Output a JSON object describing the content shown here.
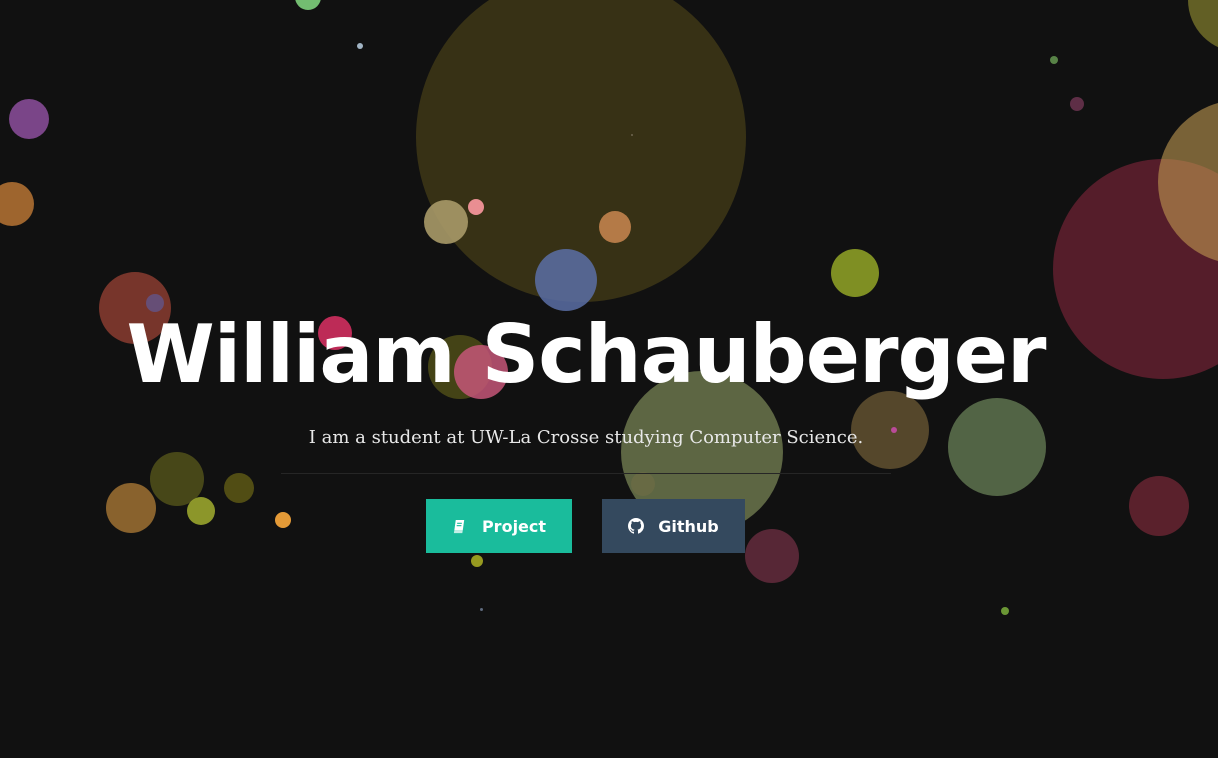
{
  "hero": {
    "name": "William Schauberger",
    "tagline": "I am a student at UW-La Crosse studying Computer Science."
  },
  "buttons": [
    {
      "label": "Project",
      "icon": "book-icon",
      "color": "#1abc9c"
    },
    {
      "label": "Github",
      "icon": "github-icon",
      "color": "#34495e"
    }
  ],
  "theme": {
    "background": "#111111",
    "text": "#ffffff"
  },
  "bubble_colors": [
    "#7ed07c",
    "#b1c7d8",
    "#8d4f9e",
    "#b77434",
    "#3a3416",
    "#a99a68",
    "#f29499",
    "#c2834d",
    "#5a6ea6",
    "#8c9d26",
    "#9a4134",
    "#5c5fa8",
    "#d02f5f",
    "#4e4c18",
    "#c45678",
    "#6b754c",
    "#665532",
    "#c54ba5",
    "#5e734f",
    "#696a45",
    "#6c2133",
    "#4e4e1a",
    "#9f7132",
    "#9aa52d",
    "#595415",
    "#f0a23a",
    "#a6aa22",
    "#76a63a",
    "#6f2f43",
    "#632330",
    "#c09a52",
    "#84802e",
    "#67324c",
    "#61904e",
    "#a89b8c",
    "#73829a"
  ]
}
